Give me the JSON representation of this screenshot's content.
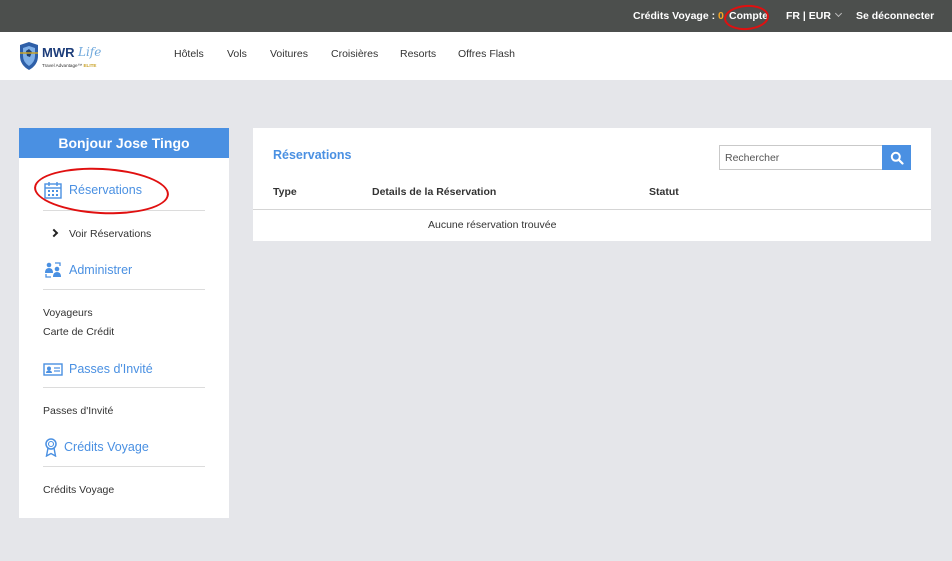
{
  "topbar": {
    "credits_label": "Crédits Voyage :",
    "credits_value": "0",
    "account": "Compte",
    "language_currency": "FR | EUR",
    "logout": "Se déconnecter"
  },
  "logo": {
    "brand": "MWR Life",
    "tagline": "Travel Advantage™ ELITE"
  },
  "nav": [
    "Hôtels",
    "Vols",
    "Voitures",
    "Croisières",
    "Resorts",
    "Offres Flash"
  ],
  "sidebar": {
    "greeting": "Bonjour Jose Tingo",
    "sections": [
      {
        "title": "Réservations",
        "icon": "calendar-icon",
        "items": [
          "Voir Réservations"
        ]
      },
      {
        "title": "Administrer",
        "icon": "people-exchange-icon",
        "items": [
          "Voyageurs",
          "Carte de Crédit"
        ]
      },
      {
        "title": "Passes d'Invité",
        "icon": "id-card-icon",
        "items": [
          "Passes d'Invité"
        ]
      },
      {
        "title": "Crédits Voyage",
        "icon": "award-icon",
        "items": [
          "Crédits Voyage"
        ]
      }
    ]
  },
  "main": {
    "title": "Réservations",
    "search_placeholder": "Rechercher",
    "columns": [
      "Type",
      "Details de la Réservation",
      "Statut"
    ],
    "empty_message": "Aucune réservation trouvée"
  },
  "colors": {
    "topbar_bg": "#4c4f4d",
    "accent": "#4a90e2",
    "credits_value": "#f5a623",
    "page_bg": "#e5e6ea",
    "annotation_red": "#e01010"
  }
}
